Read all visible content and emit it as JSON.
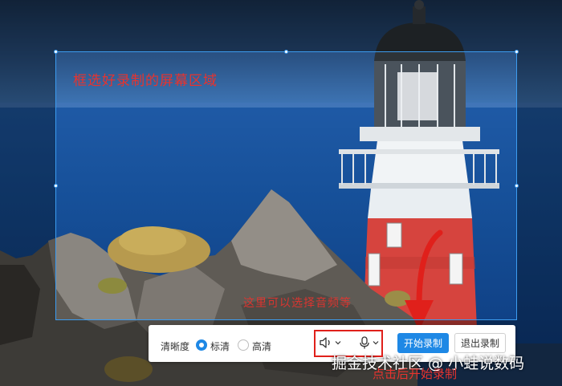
{
  "annotations": {
    "selection_label": "框选好录制的屏幕区域",
    "mid_label": "这里可以选择音频等",
    "click_hint": "点击后开始录制"
  },
  "toolbar": {
    "quality_label": "清晰度",
    "options": [
      "标清",
      "高清"
    ],
    "selected_option": "标清",
    "start_button": "开始录制",
    "exit_button": "退出录制"
  },
  "watermark": "掘金技术社区 @ 小蛙说数码",
  "colors": {
    "accent": "#1e88e5",
    "annotation": "#e8332e",
    "selection_border": "#3c9cf0"
  }
}
